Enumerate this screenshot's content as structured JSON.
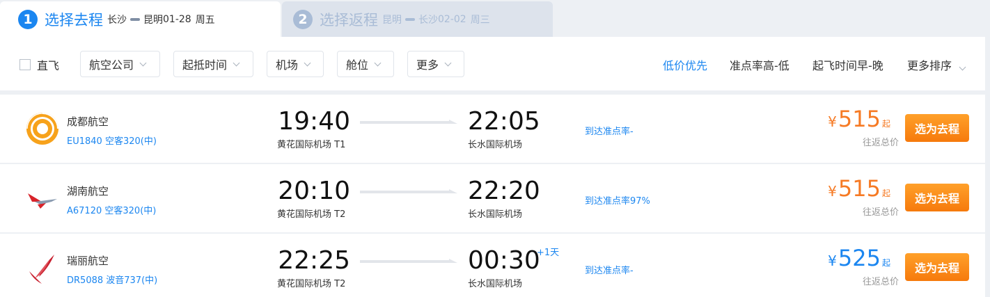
{
  "tabs": [
    {
      "step": "1",
      "title": "选择去程",
      "from": "长沙",
      "to": "昆明",
      "date": "01-28",
      "weekday": "周五"
    },
    {
      "step": "2",
      "title": "选择返程",
      "from": "昆明",
      "to": "长沙",
      "date": "02-02",
      "weekday": "周三"
    }
  ],
  "filters": {
    "direct_label": "直飞",
    "dropdowns": [
      "航空公司",
      "起抵时间",
      "机场",
      "舱位",
      "更多"
    ],
    "sorts": [
      "低价优先",
      "准点率高-低",
      "起飞时间早-晚",
      "更多排序"
    ],
    "active_sort": "低价优先"
  },
  "flights": [
    {
      "airline": "成都航空",
      "flight_no": "EU1840 空客320(中)",
      "dep_time": "19:40",
      "dep_airport": "黄花国际机场 T1",
      "arr_time": "22:05",
      "arr_airport": "长水国际机场",
      "plus_day": "",
      "ontime": "到达准点率-",
      "currency": "¥",
      "price": "515",
      "price_suffix": "起",
      "price_note": "往返总价",
      "price_color": "#f67a24",
      "button": "选为去程",
      "logo_icon": "chengdu-airlines-logo-icon"
    },
    {
      "airline": "湖南航空",
      "flight_no": "A67120 空客320(中)",
      "dep_time": "20:10",
      "dep_airport": "黄花国际机场 T2",
      "arr_time": "22:20",
      "arr_airport": "长水国际机场",
      "plus_day": "",
      "ontime": "到达准点率97%",
      "currency": "¥",
      "price": "515",
      "price_suffix": "起",
      "price_note": "往返总价",
      "price_color": "#f67a24",
      "button": "选为去程",
      "logo_icon": "hunan-airlines-logo-icon"
    },
    {
      "airline": "瑞丽航空",
      "flight_no": "DR5088 波音737(中)",
      "dep_time": "22:25",
      "dep_airport": "黄花国际机场 T2",
      "arr_time": "00:30",
      "arr_airport": "长水国际机场",
      "plus_day": "+1天",
      "ontime": "到达准点率-",
      "currency": "¥",
      "price": "525",
      "price_suffix": "起",
      "price_note": "往返总价",
      "price_color": "#1b86f0",
      "button": "选为去程",
      "logo_icon": "ruili-airlines-logo-icon"
    }
  ],
  "colors": {
    "accent": "#1b86f0",
    "orange": "#f67a24",
    "button": "#f88a14"
  }
}
